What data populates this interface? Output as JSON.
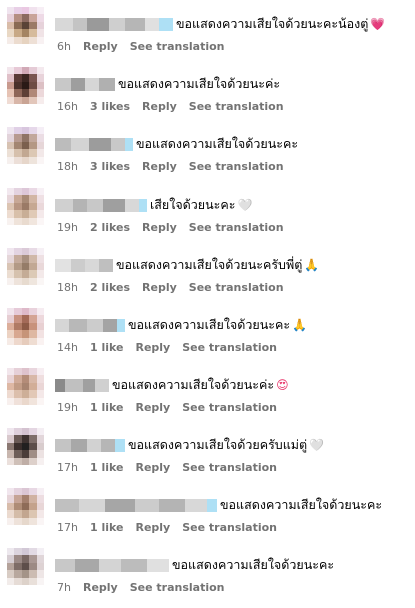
{
  "comments": [
    {
      "time": "6h",
      "likes": "",
      "reply": "Reply",
      "see_translation": "See translation",
      "text": "ขอแสดงความเสียใจด้วยนะคะน้องตู่",
      "emoji": "💗",
      "emoji_color": "#e8356a",
      "username_blocks": [
        "#d8d8d8",
        "#c4c4c4",
        "#9a9a9a",
        "#cfcfcf",
        "#b6b6b6",
        "#e0e0e0",
        "#aee0f5"
      ]
    },
    {
      "time": "16h",
      "likes": "3 likes",
      "reply": "Reply",
      "see_translation": "See translation",
      "text": "ขอแสดงความเสียใจด้วยนะค่ะ",
      "emoji": "",
      "emoji_color": "",
      "username_blocks": [
        "#c8c8c8",
        "#9e9e9e",
        "#d6d6d6",
        "#b0b0b0"
      ]
    },
    {
      "time": "18h",
      "likes": "3 likes",
      "reply": "Reply",
      "see_translation": "See translation",
      "text": "ขอแสดงความเสียใจด้วยนะคะ",
      "emoji": "",
      "emoji_color": "",
      "username_blocks": [
        "#bcbcbc",
        "#d4d4d4",
        "#9c9c9c",
        "#c8c8c8",
        "#aee0f5"
      ]
    },
    {
      "time": "19h",
      "likes": "2 likes",
      "reply": "Reply",
      "see_translation": "See translation",
      "text": "เสียใจด้วยนะคะ",
      "emoji": "🤍",
      "emoji_color": "#c9c1e8",
      "username_blocks": [
        "#d0d0d0",
        "#b4b4b4",
        "#c8c8c8",
        "#9f9f9f",
        "#d8d8d8",
        "#aee0f5"
      ]
    },
    {
      "time": "18h",
      "likes": "2 likes",
      "reply": "Reply",
      "see_translation": "See translation",
      "text": "ขอแสดงความเสียใจด้วยนะครับพี่ตู่",
      "emoji": "🙏",
      "emoji_color": "#a88ac9",
      "username_blocks": [
        "#e2e2e2",
        "#cccccc",
        "#d8d8d8",
        "#bfbfbf"
      ]
    },
    {
      "time": "14h",
      "likes": "1 like",
      "reply": "Reply",
      "see_translation": "See translation",
      "text": "ขอแสดงความเสียใจด้วยนะคะ",
      "emoji": "🙏",
      "emoji_color": "#e0b89a",
      "username_blocks": [
        "#d6d6d6",
        "#b8b8b8",
        "#cccccc",
        "#a4a4a4",
        "#aee0f5"
      ]
    },
    {
      "time": "19h",
      "likes": "1 like",
      "reply": "Reply",
      "see_translation": "See translation",
      "text": "ขอแสดงความเสียใจด้วยนะค่ะ",
      "emoji": "😍",
      "emoji_color": "#e8356a",
      "username_blocks": [
        "#8a8a8a",
        "#c0c0c0",
        "#a0a0a0",
        "#d0d0d0"
      ]
    },
    {
      "time": "17h",
      "likes": "1 like",
      "reply": "Reply",
      "see_translation": "See translation",
      "text": "ขอแสดงความเสียใจด้วยครับแม่ตู่",
      "emoji": "🤍",
      "emoji_color": "#c9c1e8",
      "username_blocks": [
        "#c4c4c4",
        "#a8a8a8",
        "#d2d2d2",
        "#b6b6b6",
        "#aee0f5"
      ]
    },
    {
      "time": "17h",
      "likes": "1 like",
      "reply": "Reply",
      "see_translation": "See translation",
      "text": "ขอแสดงความเสียใจด้วยนะคะ",
      "emoji": "",
      "emoji_color": "",
      "username_blocks": [
        "#c0c0c0",
        "#d6d6d6",
        "#a6a6a6",
        "#cccccc",
        "#b4b4b4",
        "#d8d8d8",
        "#aee0f5"
      ]
    },
    {
      "time": "7h",
      "likes": "",
      "reply": "Reply",
      "see_translation": "See translation",
      "text": "ขอแสดงความเสียใจด้วยนะคะ",
      "emoji": "",
      "emoji_color": "",
      "username_blocks": [
        "#c8c8c8",
        "#a8a8a8",
        "#d4d4d4",
        "#bcbcbc",
        "#e0e0e0"
      ]
    }
  ],
  "avatars": [
    [
      "#f0e4ef",
      "#e8cfe6",
      "#eac8e2",
      "#f1e2ee",
      "#f7eef5",
      "#e6cfd8",
      "#b58f82",
      "#8c6a60",
      "#c9a49a",
      "#eedae6",
      "#d9bca8",
      "#8a6b54",
      "#5a4336",
      "#9b7a66",
      "#e6d2da",
      "#e9d8c4",
      "#c8a986",
      "#a48462",
      "#d6bb9c",
      "#f0e3e6",
      "#f5ece8",
      "#ecdccf",
      "#e6d3c0",
      "#eee0d6",
      "#f8f1f2"
    ],
    [
      "#f3e6ec",
      "#e7c9d6",
      "#d1a9b6",
      "#e5cbd6",
      "#f4e9ee",
      "#e0c0c8",
      "#5a3a36",
      "#3b2622",
      "#7a5550",
      "#e8d3da",
      "#c89a8e",
      "#4a302a",
      "#2a1a16",
      "#6e4c44",
      "#dcc0c4",
      "#e6c3b4",
      "#8e6658",
      "#5e4036",
      "#b08878",
      "#ecd8da",
      "#f0dcd4",
      "#d8b6a8",
      "#c9a494",
      "#e2c6ba",
      "#f6ecec"
    ],
    [
      "#efe6f0",
      "#e0d0e6",
      "#d8c6de",
      "#e6d8ea",
      "#f5eef6",
      "#e2d3da",
      "#b79a90",
      "#8f7466",
      "#c2a89c",
      "#ebdde4",
      "#d7c2b2",
      "#a38672",
      "#7b604e",
      "#b49884",
      "#e6d6d8",
      "#ece0d6",
      "#d6c0ac",
      "#c2a892",
      "#dcc8b4",
      "#f2e8e8",
      "#f6f0ee",
      "#ecdfd8",
      "#e6d6ca",
      "#eee4dc",
      "#faf5f5"
    ],
    [
      "#f2e8ef",
      "#e4d3e0",
      "#ddc7d8",
      "#ead9e5",
      "#f7f0f5",
      "#e7d6da",
      "#c8a896",
      "#a88a76",
      "#d2b6a4",
      "#efe0e4",
      "#dcc4b2",
      "#b89682",
      "#9a7a66",
      "#c6a892",
      "#ead8da",
      "#eddcd0",
      "#d8c0aa",
      "#c8ae96",
      "#e0cab6",
      "#f4e9ea",
      "#f8f2f0",
      "#efe3da",
      "#e9dbcf",
      "#f1e6de",
      "#fbf6f6"
    ],
    [
      "#f0e6ef",
      "#e3d4e2",
      "#dbcad8",
      "#e8dbe6",
      "#f6f0f5",
      "#e5d6d9",
      "#c5ab9c",
      "#a89080",
      "#d0b8a8",
      "#eee0e3",
      "#d9c4b4",
      "#b39a86",
      "#957c68",
      "#c2a894",
      "#e9d8d9",
      "#ebddd1",
      "#d6c2ae",
      "#c4ac96",
      "#dccab6",
      "#f3e9e9",
      "#f7f1ef",
      "#eee3db",
      "#e7dbcf",
      "#efe6de",
      "#faf6f5"
    ],
    [
      "#f1e4ec",
      "#e6cad8",
      "#deb9c9",
      "#e9d2dc",
      "#f6ecf1",
      "#e6cdd2",
      "#c89180",
      "#a46a58",
      "#d4a494",
      "#edd8dc",
      "#dcae9a",
      "#b07a64",
      "#8e5a46",
      "#c8927c",
      "#e8d0d2",
      "#ecd2c2",
      "#d8a890",
      "#c69478",
      "#deb8a2",
      "#f2e2e2",
      "#f6ebe6",
      "#eed8cc",
      "#e6ccbc",
      "#efddd2",
      "#faf2f1"
    ],
    [
      "#f2e6ec",
      "#e6d0d8",
      "#dec2cc",
      "#e9d6de",
      "#f7eef2",
      "#e8d2d4",
      "#d0aa98",
      "#b48c78",
      "#d8b8a8",
      "#efdedf",
      "#deb8a4",
      "#c29c86",
      "#a88470",
      "#d2ae98",
      "#ead6d6",
      "#eedad0",
      "#dcbfac",
      "#cdaf98",
      "#e2c8b6",
      "#f4e8e8",
      "#f8f0ee",
      "#f0e1da",
      "#ead8cc",
      "#f1e4dc",
      "#fbf5f4"
    ],
    [
      "#efe6ee",
      "#dfd0dc",
      "#d4c2d0",
      "#e4d6e2",
      "#f4eef3",
      "#d8c8cc",
      "#6a5a56",
      "#3e3230",
      "#7e6e6a",
      "#e2d6da",
      "#8a7872",
      "#3a2e2c",
      "#222020",
      "#5c4e4a",
      "#d8cccd",
      "#c8b6ae",
      "#6e5e58",
      "#4a3c38",
      "#a08e86",
      "#ece2e2",
      "#ebe0dc",
      "#cfc0b8",
      "#bfaea6",
      "#ddd0ca",
      "#f6f0f0"
    ],
    [
      "#f1e6ee",
      "#e4d2de",
      "#dbc6d4",
      "#e8d8e4",
      "#f6eff4",
      "#e6d4d8",
      "#c6a496",
      "#a4806e",
      "#d0b2a2",
      "#eddde1",
      "#d8bcaa",
      "#ae8c76",
      "#8e6c58",
      "#c4a28c",
      "#e8d6d7",
      "#ebdacf",
      "#d4bca8",
      "#c2a690",
      "#dcc6b2",
      "#f3e8e8",
      "#f7f0ee",
      "#eee2da",
      "#e6d8cc",
      "#efe4dc",
      "#faf5f5"
    ],
    [
      "#ede8ee",
      "#dcd4de",
      "#d2c8d6",
      "#e2dae4",
      "#f3eff4",
      "#d6cdd2",
      "#9c8a86",
      "#7a6864",
      "#aa9894",
      "#e0d6d9",
      "#b4a29a",
      "#7e6c66",
      "#5e4e4a",
      "#9c8a84",
      "#ddd2d3",
      "#d8ccc4",
      "#b8a89e",
      "#a49488",
      "#ccbcb2",
      "#eee6e6",
      "#f2ecea",
      "#e6dcd6",
      "#ddd2ca",
      "#e9e0da",
      "#f8f4f4"
    ]
  ]
}
